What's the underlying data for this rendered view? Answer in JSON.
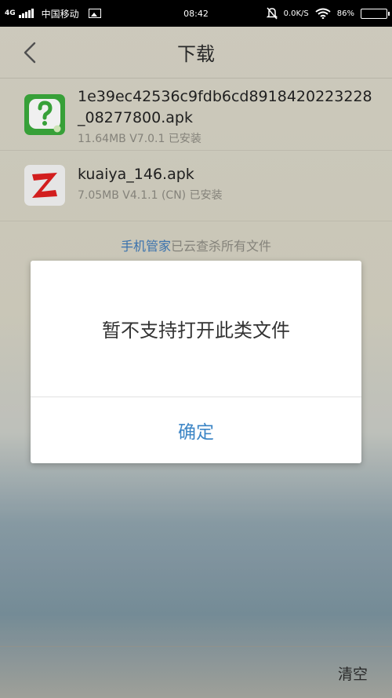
{
  "status_bar": {
    "network": "4G",
    "carrier": "中国移动",
    "time": "08:42",
    "speed": "0.0K/S",
    "battery": "86%",
    "battery_level": 0.86
  },
  "header": {
    "title": "下载"
  },
  "files": [
    {
      "name": "1e39ec42536c9fdb6cd8918420223228_08277800.apk",
      "meta": "11.64MB  V7.0.1 已安装",
      "icon": "question-app-icon",
      "color": "#3bab3c"
    },
    {
      "name": "kuaiya_146.apk",
      "meta": "7.05MB  V4.1.1 (CN) 已安装",
      "icon": "kuaiya-app-icon",
      "color": "#e02020"
    }
  ],
  "scan_note": {
    "link": "手机管家",
    "text": "已云查杀所有文件"
  },
  "dialog": {
    "message": "暂不支持打开此类文件",
    "ok_label": "确定"
  },
  "bottom_bar": {
    "clear_label": "清空"
  },
  "colors": {
    "accent": "#3d86c6",
    "link": "#3d79b8"
  }
}
